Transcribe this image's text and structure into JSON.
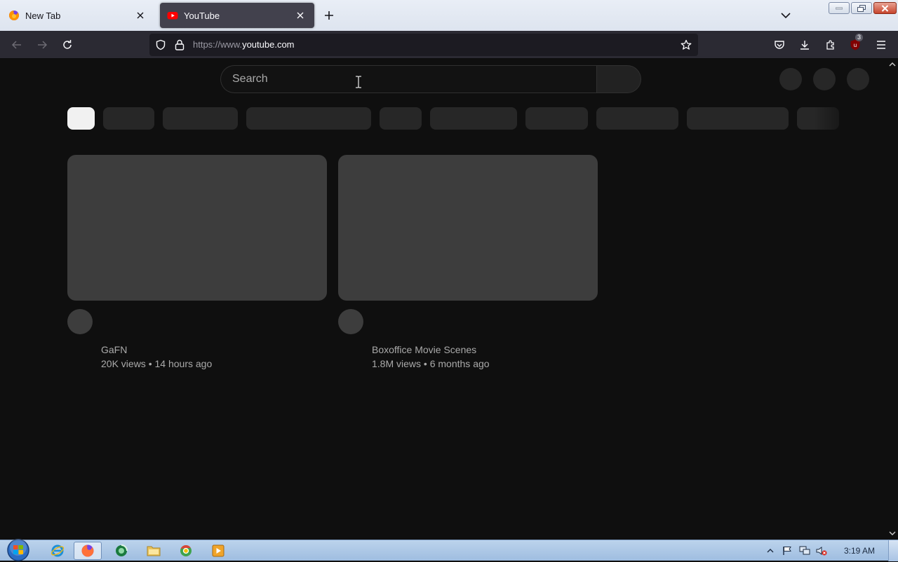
{
  "browser": {
    "tabs": [
      {
        "title": "New Tab",
        "favicon": "firefox-icon",
        "active": false
      },
      {
        "title": "YouTube",
        "favicon": "youtube-icon",
        "active": true
      }
    ],
    "url": {
      "prefix": "https://www.",
      "host": "youtube.com"
    },
    "toolbar_icons": [
      "back-icon",
      "forward-icon",
      "reload-icon",
      "shield-icon",
      "lock-icon",
      "star-icon",
      "pocket-icon",
      "download-icon",
      "extensions-icon",
      "ublock-icon",
      "menu-icon"
    ],
    "ublock_badge": "3"
  },
  "youtube": {
    "search_placeholder": "Search",
    "videos": [
      {
        "channel": "GaFN",
        "views": "20K views",
        "age": "14 hours ago"
      },
      {
        "channel": "Boxoffice Movie Scenes",
        "views": "1.8M views",
        "age": "6 months ago"
      }
    ]
  },
  "taskbar": {
    "apps": [
      "internet-explorer-icon",
      "firefox-icon",
      "media-center-icon",
      "file-explorer-icon",
      "chrome-icon",
      "media-player-icon"
    ],
    "tray": [
      "show-hidden-icon",
      "flag-icon",
      "network-icon",
      "volume-muted-icon"
    ],
    "clock": "3:19 AM"
  },
  "colors": {
    "page_bg": "#0f0f0f",
    "placeholder": "#3d3d3d",
    "chip": "#272727",
    "toolbar": "#2b2a33"
  }
}
